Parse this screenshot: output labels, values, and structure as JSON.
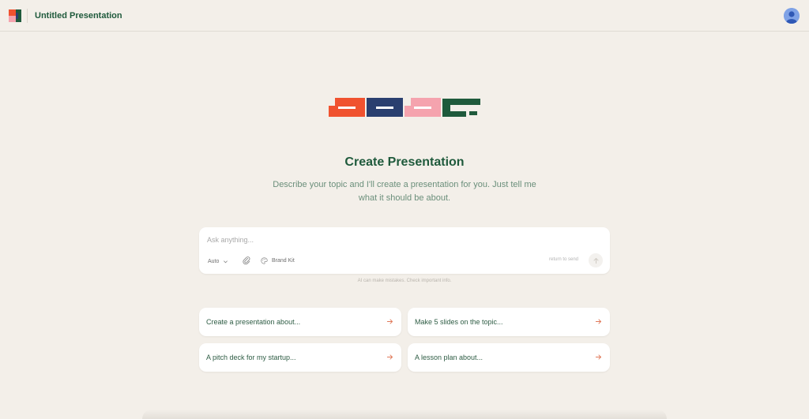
{
  "header": {
    "title": "Untitled Presentation",
    "logo_icon": "app-logo-icon",
    "avatar_icon": "user-avatar-icon"
  },
  "hero": {
    "title": "Create Presentation",
    "subtitle": "Describe your topic and I'll create a presentation for you. Just tell me what it should be about."
  },
  "prompt": {
    "placeholder": "Ask anything...",
    "mode_label": "Auto",
    "brand_kit_label": "Brand Kit",
    "send_hint": "return to send",
    "disclaimer": "AI can make mistakes. Check important info."
  },
  "suggestions": [
    {
      "label": "Create a presentation about..."
    },
    {
      "label": "Make 5 slides on the topic..."
    },
    {
      "label": "A pitch deck for my startup..."
    },
    {
      "label": "A lesson plan about..."
    }
  ],
  "colors": {
    "background": "#f3efe9",
    "brand_green": "#1f5a3c",
    "brand_orange": "#f0522f",
    "brand_navy": "#2a3f6f",
    "brand_pink": "#f5a3ae",
    "accent_arrow": "#e0795a"
  }
}
